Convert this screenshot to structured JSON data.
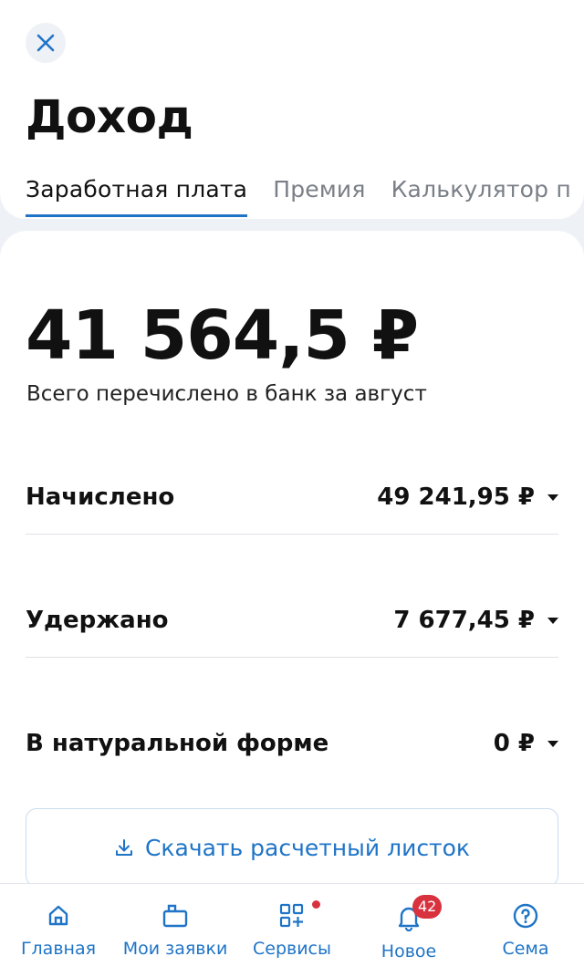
{
  "header": {
    "close_icon": "close-icon",
    "title": "Доход",
    "tabs": [
      {
        "label": "Заработная плата",
        "active": true
      },
      {
        "label": "Премия",
        "active": false
      },
      {
        "label": "Калькулятор п",
        "active": false
      }
    ]
  },
  "summary": {
    "amount": "41 564,5 ₽",
    "caption": "Всего перечислено в банк за август"
  },
  "rows": [
    {
      "label": "Начислено",
      "value": "49 241,95 ₽"
    },
    {
      "label": "Удержано",
      "value": "7 677,45 ₽"
    },
    {
      "label": "В натуральной форме",
      "value": "0 ₽"
    }
  ],
  "download": {
    "label": "Скачать расчетный листок",
    "icon": "download-icon"
  },
  "nav": {
    "items": [
      {
        "label": "Главная",
        "icon": "home-icon"
      },
      {
        "label": "Мои заявки",
        "icon": "requests-icon"
      },
      {
        "label": "Сервисы",
        "icon": "services-icon"
      },
      {
        "label": "Новое",
        "icon": "bell-icon",
        "badge": "42"
      },
      {
        "label": "Сема",
        "icon": "help-icon"
      }
    ]
  },
  "colors": {
    "accent": "#1f74c7",
    "background": "#eef1f6",
    "badge": "#d8323f"
  }
}
